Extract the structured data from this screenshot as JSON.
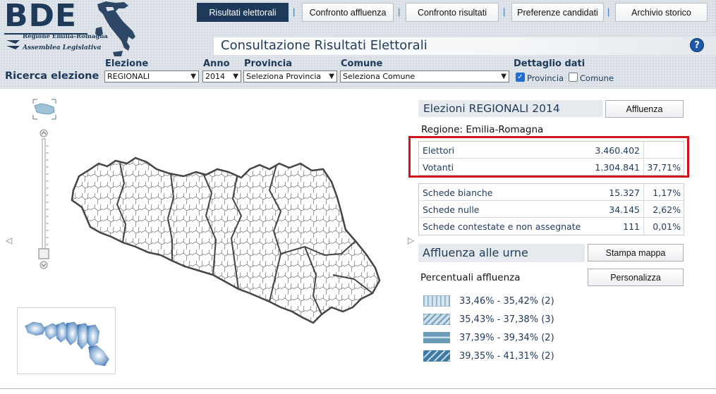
{
  "logo": {
    "brand": "BDE",
    "line1": "Regione Emilia-Romagna",
    "line2": "Assemblea Legislativa"
  },
  "nav": {
    "items": [
      {
        "label": "Risultati elettorali",
        "active": true
      },
      {
        "label": "Confronto affluenza",
        "active": false
      },
      {
        "label": "Confronto risultati",
        "active": false
      },
      {
        "label": "Preferenze candidati",
        "active": false
      },
      {
        "label": "Archivio storico",
        "active": false
      }
    ],
    "separator": "|"
  },
  "page_title": "Consultazione Risultati Elettorali",
  "help_icon": "help-icon",
  "search": {
    "title": "Ricerca elezione",
    "elezione": {
      "label": "Elezione",
      "value": "REGIONALI"
    },
    "anno": {
      "label": "Anno",
      "value": "2014"
    },
    "provincia": {
      "label": "Provincia",
      "value": "Seleziona Provincia"
    },
    "comune": {
      "label": "Comune",
      "value": "Seleziona Comune"
    },
    "dettaglio": {
      "label": "Dettaglio dati",
      "provincia": {
        "label": "Provincia",
        "checked": true
      },
      "comune": {
        "label": "Comune",
        "checked": false
      }
    }
  },
  "results": {
    "title": "Elezioni REGIONALI 2014",
    "affluenza_button": "Affluenza",
    "region": "Regione: Emilia-Romagna",
    "table1": [
      {
        "label": "Elettori",
        "value": "3.460.402",
        "pct": ""
      },
      {
        "label": "Votanti",
        "value": "1.304.841",
        "pct": "37,71%"
      }
    ],
    "table2": [
      {
        "label": "Schede bianche",
        "value": "15.327",
        "pct": "1,17%"
      },
      {
        "label": "Schede nulle",
        "value": "34.145",
        "pct": "2,62%"
      },
      {
        "label": "Schede contestate e non assegnate",
        "value": "111",
        "pct": "0,01%"
      }
    ]
  },
  "turnout": {
    "title": "Affluenza alle urne",
    "stampa_button": "Stampa mappa",
    "perc_label": "Percentuali affluenza",
    "personalizza_button": "Personalizza",
    "legend": [
      {
        "range": "33,46% - 35,42% (2)",
        "pattern": "vertical",
        "color": "#a9c6d6"
      },
      {
        "range": "35,43% - 37,38% (3)",
        "pattern": "diagonal-light",
        "color": "#8fb4c9"
      },
      {
        "range": "37,39% - 39,34% (2)",
        "pattern": "horizontal",
        "color": "#6a9bb9"
      },
      {
        "range": "39,35% - 41,31% (2)",
        "pattern": "diagonal-dark",
        "color": "#3f7aa3"
      }
    ]
  },
  "colors": {
    "brand_navy": "#1e3a5a",
    "highlight_red": "#d1141c",
    "link_blue": "#3a72b4"
  }
}
